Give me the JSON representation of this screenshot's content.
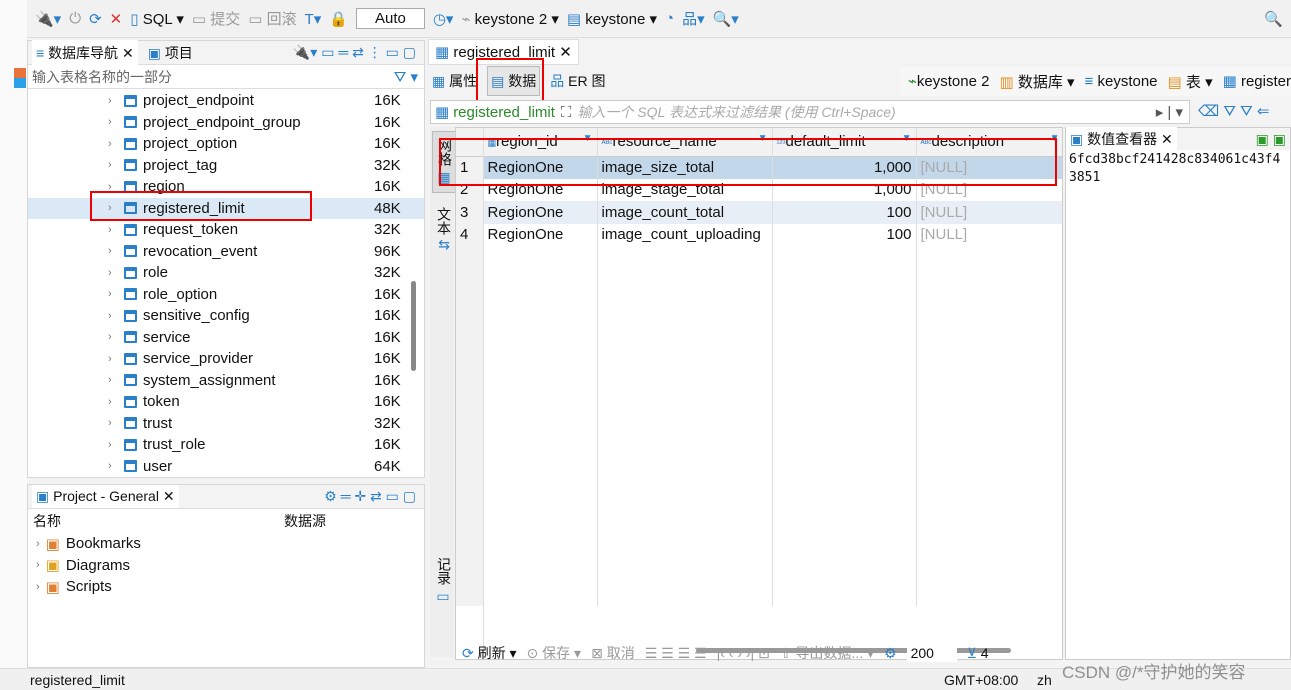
{
  "toolbar": {
    "sql": "SQL",
    "commit": "提交",
    "rollback": "回滚",
    "mode": "Auto",
    "connection": "keystone 2",
    "database": "keystone"
  },
  "nav": {
    "tab_db": "数据库导航",
    "tab_project": "项目",
    "filter_placeholder": "输入表格名称的一部分",
    "tables": [
      {
        "name": "project_endpoint",
        "size": "16K"
      },
      {
        "name": "project_endpoint_group",
        "size": "16K"
      },
      {
        "name": "project_option",
        "size": "16K"
      },
      {
        "name": "project_tag",
        "size": "32K"
      },
      {
        "name": "region",
        "size": "16K"
      },
      {
        "name": "registered_limit",
        "size": "48K",
        "selected": true
      },
      {
        "name": "request_token",
        "size": "32K"
      },
      {
        "name": "revocation_event",
        "size": "96K"
      },
      {
        "name": "role",
        "size": "32K"
      },
      {
        "name": "role_option",
        "size": "16K"
      },
      {
        "name": "sensitive_config",
        "size": "16K"
      },
      {
        "name": "service",
        "size": "16K"
      },
      {
        "name": "service_provider",
        "size": "16K"
      },
      {
        "name": "system_assignment",
        "size": "16K"
      },
      {
        "name": "token",
        "size": "16K"
      },
      {
        "name": "trust",
        "size": "32K"
      },
      {
        "name": "trust_role",
        "size": "16K"
      },
      {
        "name": "user",
        "size": "64K"
      }
    ]
  },
  "project": {
    "title": "Project - General",
    "col_name": "名称",
    "col_source": "数据源",
    "items": [
      "Bookmarks",
      "Diagrams",
      "Scripts"
    ]
  },
  "editor": {
    "tab": "registered_limit",
    "sub_props": "属性",
    "sub_data": "数据",
    "sub_er": "ER 图",
    "crumbs": [
      "keystone 2",
      "数据库",
      "keystone",
      "表",
      "register"
    ],
    "filter_table": "registered_limit",
    "filter_placeholder": "输入一个 SQL 表达式来过滤结果 (使用 Ctrl+Space)",
    "vtabs": [
      "网格",
      "文本",
      "记录"
    ],
    "columns": [
      "region_id",
      "resource_name",
      "default_limit",
      "description"
    ],
    "rows": [
      [
        "1",
        "RegionOne",
        "image_size_total",
        "1,000",
        "[NULL]"
      ],
      [
        "2",
        "RegionOne",
        "image_stage_total",
        "1,000",
        "[NULL]"
      ],
      [
        "3",
        "RegionOne",
        "image_count_total",
        "100",
        "[NULL]"
      ],
      [
        "4",
        "RegionOne",
        "image_count_uploading",
        "100",
        "[NULL]"
      ]
    ],
    "viewer_title": "数值查看器",
    "viewer_value": "6fcd38bcf241428c834061c43f43851",
    "refresh": "刷新",
    "save": "保存",
    "cancel": "取消",
    "export": "导出数据...",
    "fetch": "200",
    "count": "4"
  },
  "status": {
    "left": "registered_limit",
    "tz": "GMT+08:00",
    "lang": "zh",
    "watermark": "CSDN @/*守护她的笑容"
  }
}
